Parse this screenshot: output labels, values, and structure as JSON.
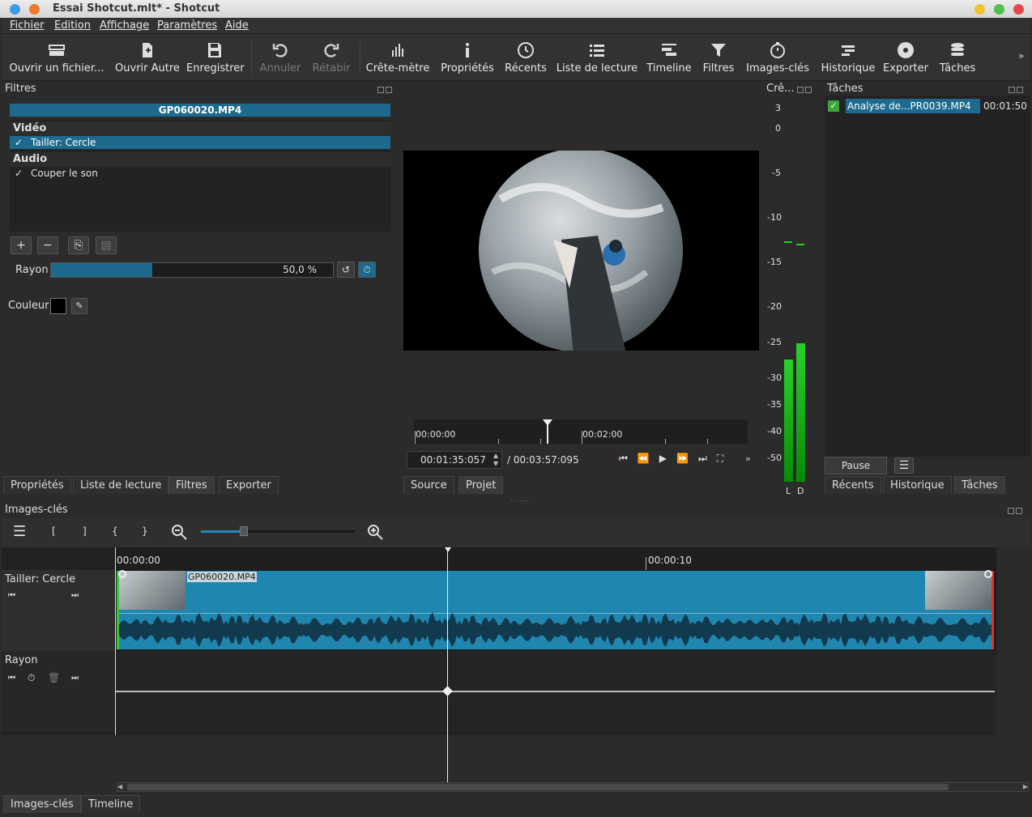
{
  "window": {
    "title": "Essai Shotcut.mlt* - Shotcut"
  },
  "menu": [
    "Fichier",
    "Edition",
    "Affichage",
    "Paramètres",
    "Aide"
  ],
  "toolbar": [
    {
      "label": "Ouvrir un fichier...",
      "icon": "open-file-icon"
    },
    {
      "label": "Ouvrir Autre",
      "icon": "open-other-icon"
    },
    {
      "label": "Enregistrer",
      "icon": "save-icon"
    },
    {
      "label": "Annuler",
      "icon": "undo-icon"
    },
    {
      "label": "Rétabir",
      "icon": "redo-icon"
    },
    {
      "label": "Crête-mètre",
      "icon": "peak-meter-icon"
    },
    {
      "label": "Propriétés",
      "icon": "info-icon"
    },
    {
      "label": "Récents",
      "icon": "clock-icon"
    },
    {
      "label": "Liste de lecture",
      "icon": "playlist-icon"
    },
    {
      "label": "Timeline",
      "icon": "timeline-icon"
    },
    {
      "label": "Filtres",
      "icon": "filter-icon"
    },
    {
      "label": "Images-clés",
      "icon": "stopwatch-icon"
    },
    {
      "label": "Historique",
      "icon": "history-icon"
    },
    {
      "label": "Exporter",
      "icon": "export-icon"
    },
    {
      "label": "Tâches",
      "icon": "jobs-icon"
    }
  ],
  "filters": {
    "title": "Filtres",
    "clip": "GP060020.MP4",
    "video_header": "Vidéo",
    "video_filter": "Tailler: Cercle",
    "audio_header": "Audio",
    "audio_filter": "Couper le son",
    "rayon_label": "Rayon",
    "rayon_value": "50,0 %",
    "rayon_fraction": 0.36,
    "couleur_label": "Couleur"
  },
  "left_tabs": [
    "Propriétés",
    "Liste de lecture",
    "Filtres",
    "Exporter"
  ],
  "player": {
    "ruler_start": "00:00:00",
    "ruler_mid": "00:02:00",
    "position": "00:01:35:057",
    "duration": "/ 00:03:57:095",
    "tabs": [
      "Source",
      "Projet"
    ]
  },
  "meter": {
    "title": "Crê...",
    "ticks": [
      "3",
      "0",
      "-5",
      "-10",
      "-15",
      "-20",
      "-25",
      "-30",
      "-35",
      "-40",
      "-50"
    ],
    "channels": [
      "L",
      "D"
    ]
  },
  "jobs": {
    "title": "Tâches",
    "job_name": "Analyse de...PR0039.MP4",
    "job_time": "00:01:50",
    "pause_label": "Pause",
    "tabs": [
      "Récents",
      "Historique",
      "Tâches"
    ]
  },
  "keyframes": {
    "title": "Images-clés",
    "time_start": "00:00:00",
    "time_10": "00:00:10",
    "clip_track": "Tailler: Cercle",
    "clip_name": "GP060020.MP4",
    "param_track": "Rayon",
    "bottom_tabs": [
      "Images-clés",
      "Timeline"
    ]
  }
}
